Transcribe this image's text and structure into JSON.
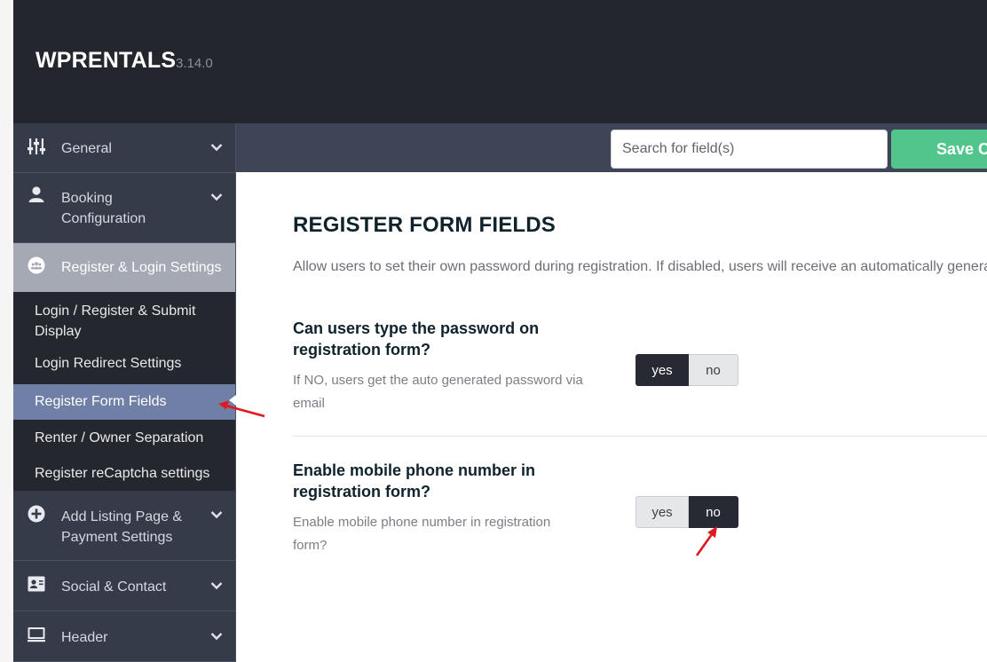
{
  "app": {
    "brand": "WPRENTALS",
    "version": "3.14.0"
  },
  "sidebar": {
    "items": [
      {
        "label": "General",
        "icon": "sliders-icon"
      },
      {
        "label": "Booking Configuration",
        "icon": "user-icon"
      },
      {
        "label": "Register & Login Settings",
        "icon": "users-circle-icon"
      },
      {
        "label": "Add Listing Page & Payment Settings",
        "icon": "plus-circle-icon"
      },
      {
        "label": "Social & Contact",
        "icon": "contact-card-icon"
      },
      {
        "label": "Header",
        "icon": "monitor-icon"
      }
    ],
    "sub_items": [
      {
        "label": "Login / Register & Submit Display"
      },
      {
        "label": "Login Redirect Settings"
      },
      {
        "label": "Register Form Fields"
      },
      {
        "label": "Renter / Owner Separation"
      },
      {
        "label": "Register reCaptcha settings"
      }
    ]
  },
  "toolbar": {
    "search_placeholder": "Search for field(s)",
    "save_label": "Save Changes"
  },
  "main": {
    "title": "REGISTER FORM FIELDS",
    "description": "Allow users to set their own password during registration. If disabled, users will receive an automatically generated password via email.",
    "fields": [
      {
        "title": "Can users type the password on registration form?",
        "help": "If NO, users get the auto generated password via email",
        "options": [
          "yes",
          "no"
        ],
        "selected": "yes"
      },
      {
        "title": "Enable mobile phone number in registration form?",
        "help": "Enable mobile phone number in registration form?",
        "options": [
          "yes",
          "no"
        ],
        "selected": "no"
      }
    ]
  },
  "colors": {
    "topbar": "#23262d",
    "sidebar": "#363b4a",
    "active_menu": "#a4a9b3",
    "current_submenu": "#6f7fa6",
    "save": "#51c58b",
    "toggle_on": "#272a33",
    "annotation_arrow": "#e0191e"
  }
}
